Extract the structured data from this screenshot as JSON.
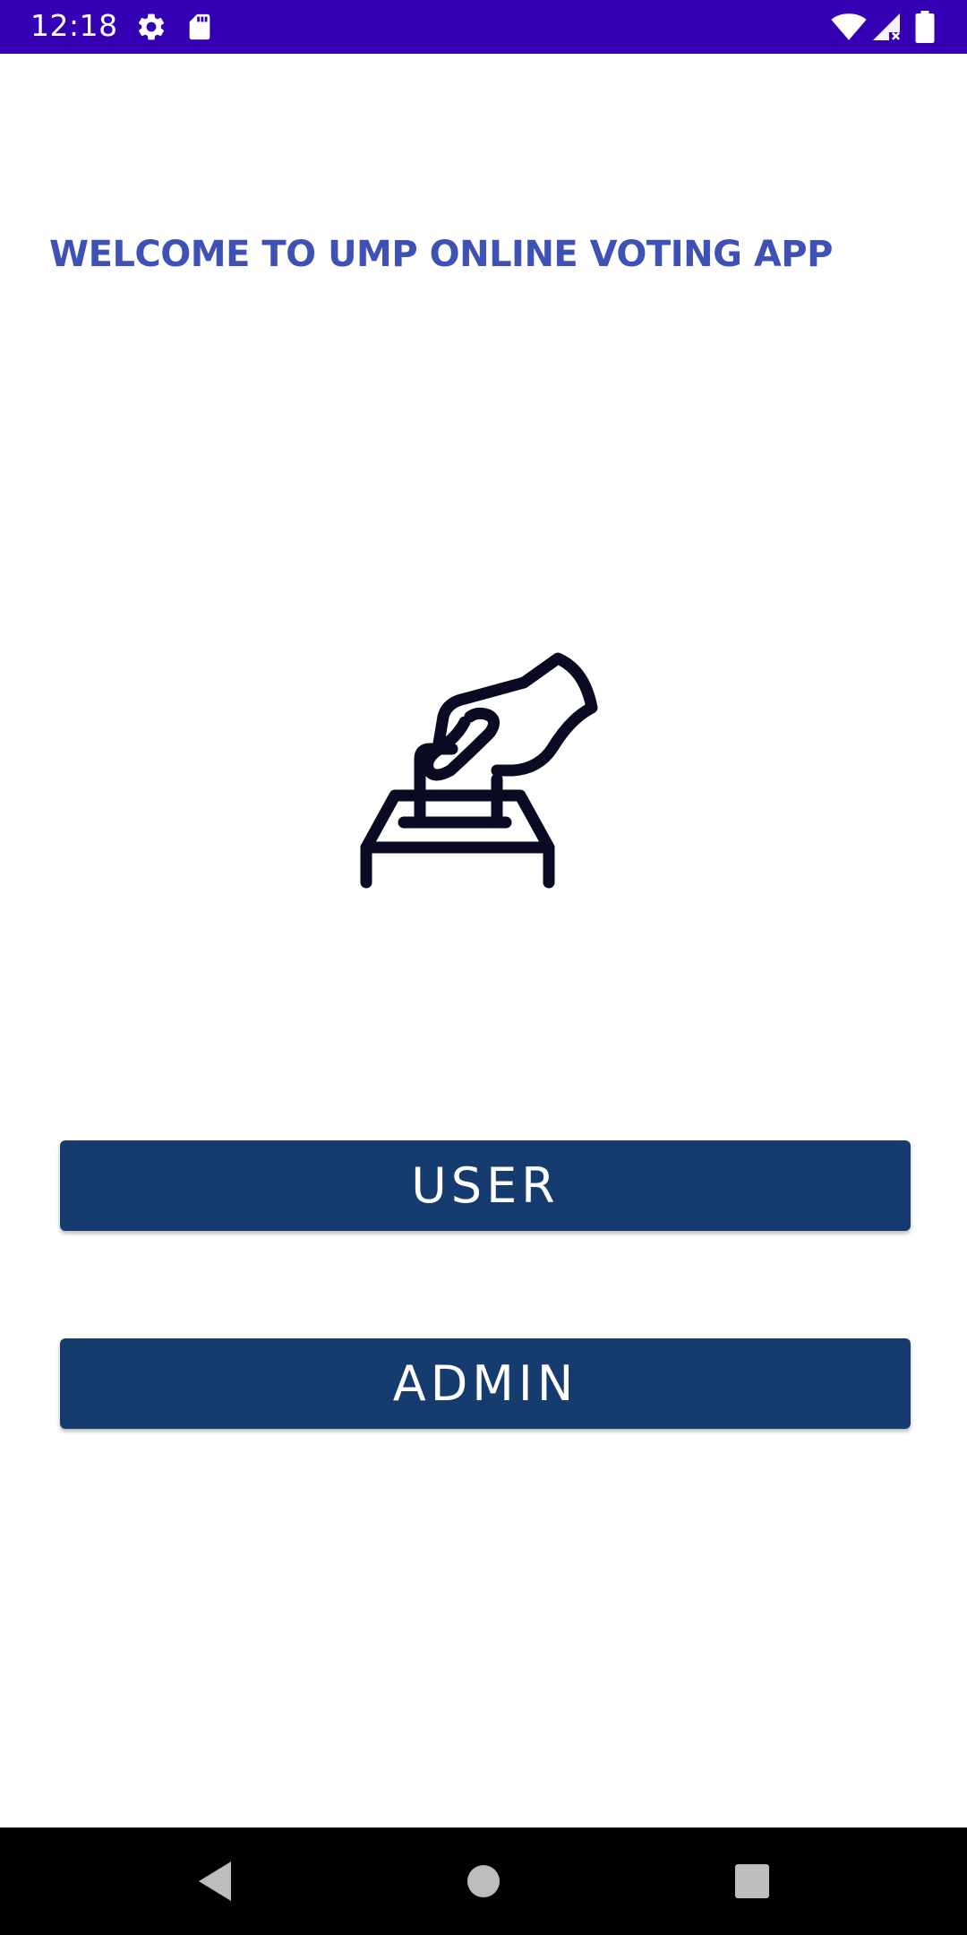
{
  "status_bar": {
    "time": "12:18",
    "background": "#3500b3",
    "icons": [
      "settings-icon",
      "sd-card-icon",
      "wifi-icon",
      "cell-signal-icon",
      "battery-icon"
    ]
  },
  "welcome": {
    "title": "WELCOME TO UMP ONLINE VOTING APP",
    "color": "#3f51b5"
  },
  "illustration": {
    "icon": "ballot-box-vote-icon"
  },
  "buttons": {
    "user_label": "USER",
    "admin_label": "ADMIN",
    "background": "#153b6f"
  },
  "nav_bar": {
    "icons": [
      "back-icon",
      "home-icon",
      "recents-icon"
    ]
  }
}
